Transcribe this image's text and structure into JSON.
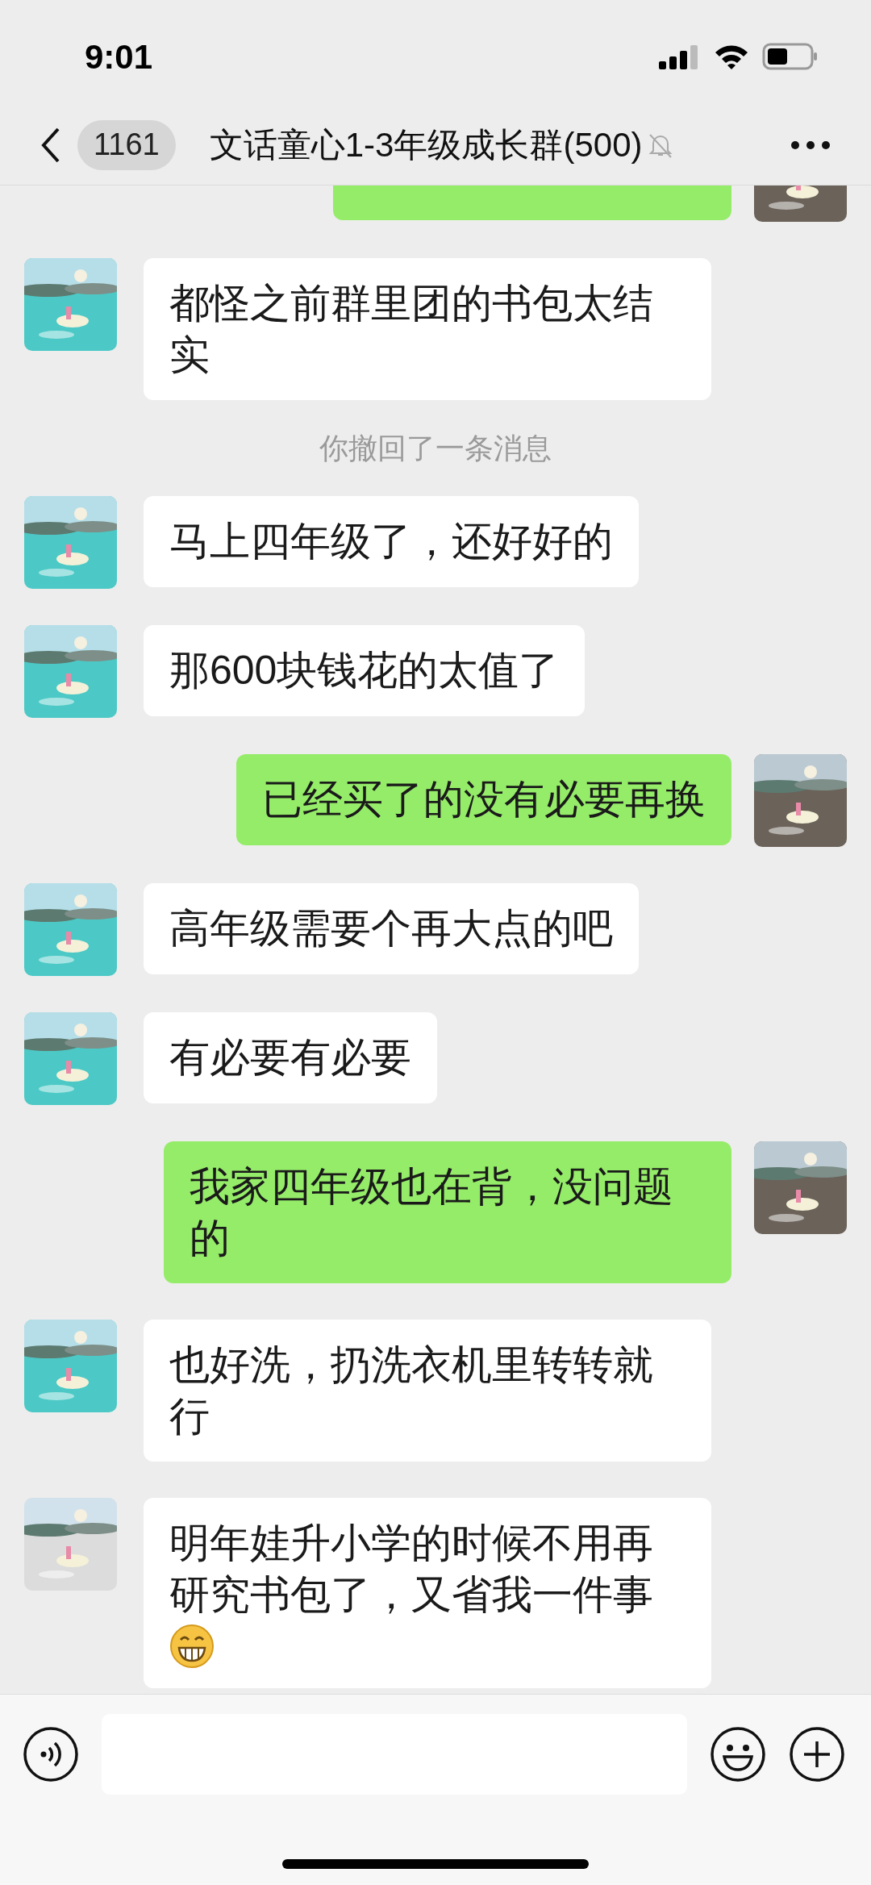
{
  "status_bar": {
    "time": "9:01"
  },
  "header": {
    "back_count": "1161",
    "title": "文话童心1-3年级成长群(500)",
    "muted": true
  },
  "messages": [
    {
      "kind": "outgoing"
    },
    {
      "kind": "incoming",
      "text": "都怪之前群里团的书包太结实"
    },
    {
      "kind": "system",
      "text": "你撤回了一条消息"
    },
    {
      "kind": "incoming",
      "text": "马上四年级了，还好好的"
    },
    {
      "kind": "incoming",
      "text": "那600块钱花的太值了"
    },
    {
      "kind": "outgoing",
      "text": "已经买了的没有必要再换"
    },
    {
      "kind": "incoming",
      "text": "高年级需要个再大点的吧"
    },
    {
      "kind": "incoming",
      "text": "有必要有必要"
    },
    {
      "kind": "outgoing",
      "text": "我家四年级也在背，没问题的"
    },
    {
      "kind": "incoming",
      "text": "也好洗，扔洗衣机里转转就行"
    },
    {
      "kind": "incoming",
      "text": "明年娃升小学的时候不用再研究书包了，又省我一件事",
      "grin_emoji": true
    }
  ]
}
